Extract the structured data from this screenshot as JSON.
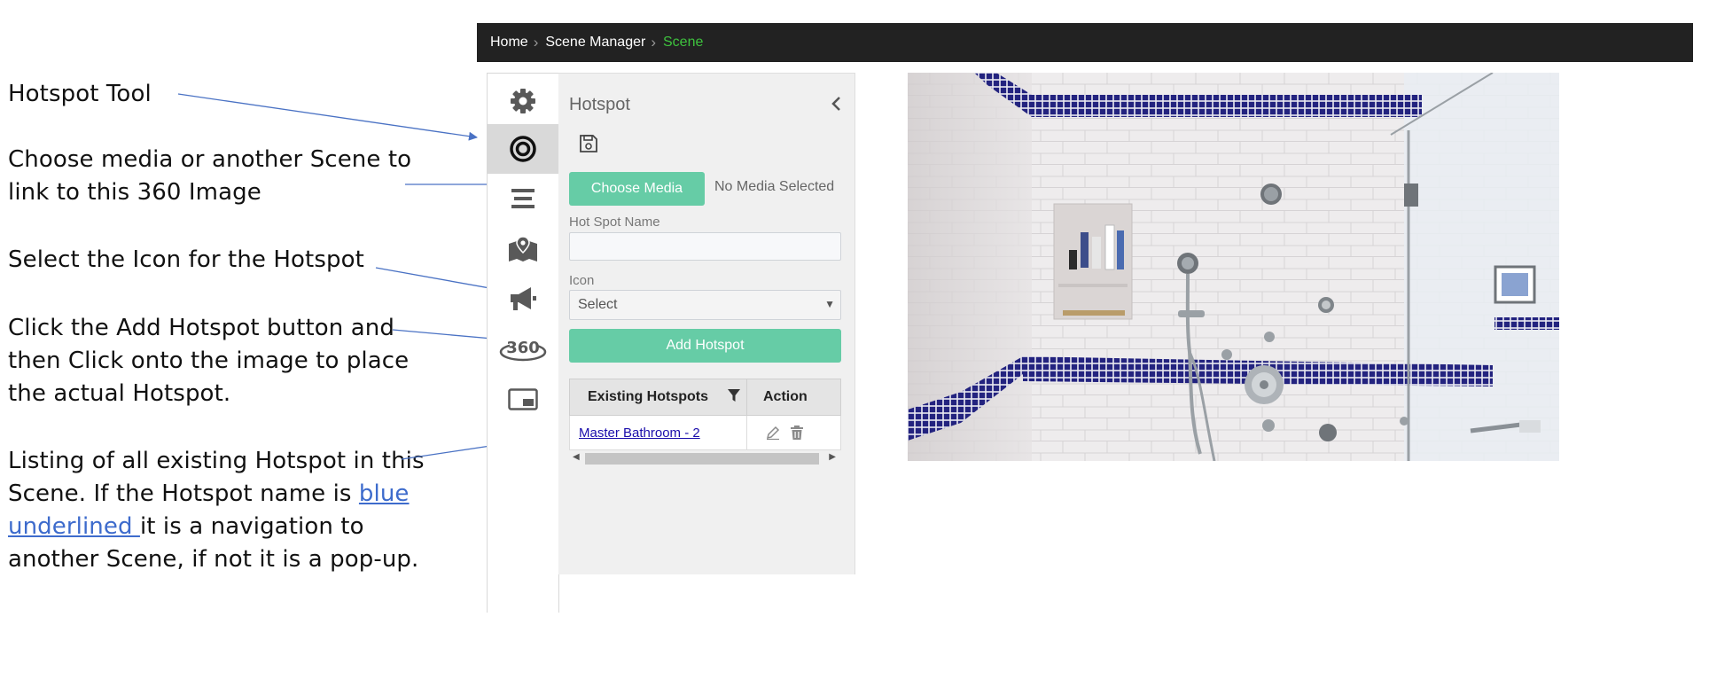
{
  "annotations": {
    "hotspot_tool": "Hotspot Tool",
    "choose_media_l1": "Choose media or another Scene to",
    "choose_media_l2": "link to this 360 Image",
    "select_icon": "Select the Icon for the Hotspot",
    "add_l1": "Click the Add Hotspot button and",
    "add_l2": "then Click onto the image to place",
    "add_l3": "the actual Hotspot.",
    "list_l1": "Listing of all existing Hotspot in this",
    "list_l2": "Scene.  If the Hotspot name is ",
    "list_link1": "blue",
    "list_link2": "underlined ",
    "list_l3": "it is a navigation to",
    "list_l4": "another Scene, if not it is a pop-up."
  },
  "breadcrumb": {
    "home": "Home",
    "manager": "Scene Manager",
    "current": "Scene"
  },
  "toolbar": {
    "icons": [
      "gear-icon",
      "target-icon",
      "list-icon",
      "map-icon",
      "megaphone-icon",
      "360-icon",
      "picture-in-picture-icon"
    ],
    "active_index": 1
  },
  "panel": {
    "title": "Hotspot",
    "choose_media": "Choose Media",
    "no_media": "No Media Selected",
    "name_label": "Hot Spot Name",
    "name_value": "",
    "icon_label": "Icon",
    "icon_select": "Select",
    "add_button": "Add Hotspot",
    "table": {
      "headers": [
        "Existing Hotspots",
        "Action"
      ],
      "rows": [
        {
          "name": "Master Bathroom - 2"
        }
      ]
    }
  },
  "colors": {
    "accent_green": "#66cca6",
    "breadcrumb_active": "#3ec23e",
    "navbar": "#222222",
    "tile_blue": "#23237f"
  }
}
